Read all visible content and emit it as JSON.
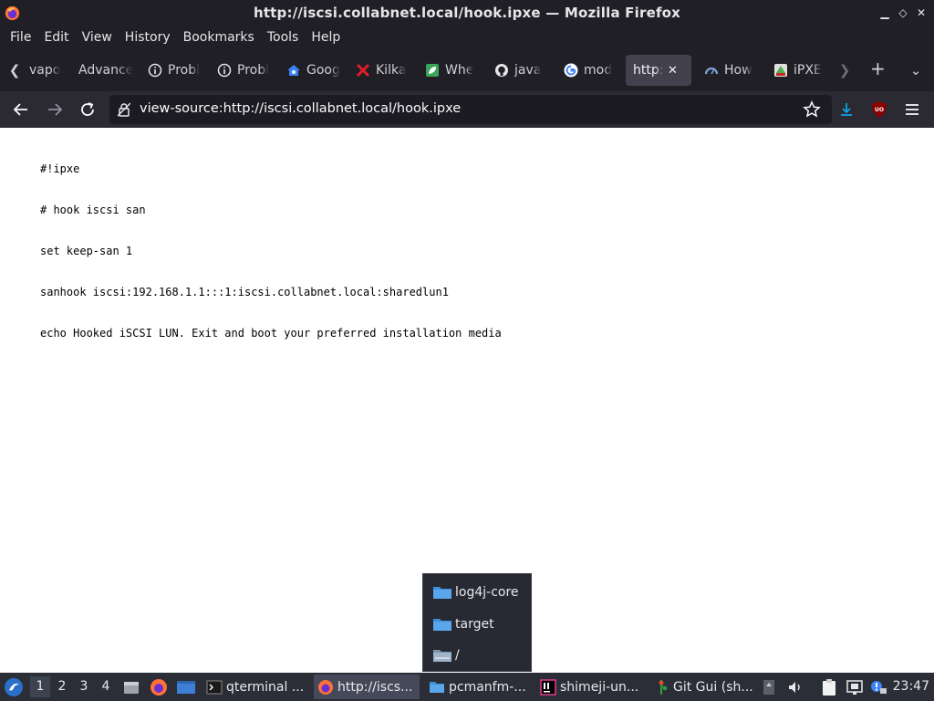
{
  "window": {
    "title": "http://iscsi.collabnet.local/hook.ipxe — Mozilla Firefox"
  },
  "menu": [
    "File",
    "Edit",
    "View",
    "History",
    "Bookmarks",
    "Tools",
    "Help"
  ],
  "tabs": [
    {
      "label": "vapo",
      "icon": "none"
    },
    {
      "label": "Advance",
      "icon": "none"
    },
    {
      "label": "Probl",
      "icon": "info-icon"
    },
    {
      "label": "Probl",
      "icon": "info-icon"
    },
    {
      "label": "Goog",
      "icon": "home-icon"
    },
    {
      "label": "Kilka",
      "icon": "cross-icon"
    },
    {
      "label": "Whe",
      "icon": "leaf-icon"
    },
    {
      "label": "java",
      "icon": "github-icon"
    },
    {
      "label": "mod",
      "icon": "google-icon"
    },
    {
      "label": "http://",
      "icon": "none",
      "active": true
    },
    {
      "label": "How",
      "icon": "speedometer-icon"
    },
    {
      "label": "iPXE",
      "icon": "ipxe-icon"
    }
  ],
  "address_bar": {
    "url": "view-source:http://iscsi.collabnet.local/hook.ipxe"
  },
  "source": {
    "lines": [
      "#!ipxe",
      "# hook iscsi san",
      "set keep-san 1",
      "sanhook iscsi:192.168.1.1:::1:iscsi.collabnet.local:sharedlun1",
      "echo Hooked iSCSI LUN. Exit and boot your preferred installation media"
    ]
  },
  "popup_menu": {
    "items": [
      "log4j-core",
      "target",
      "/"
    ]
  },
  "taskbar": {
    "workspaces": [
      "1",
      "2",
      "3",
      "4"
    ],
    "active_workspace": "1",
    "tasks": [
      {
        "label": "qterminal ...",
        "icon": "terminal-icon"
      },
      {
        "label": "http://iscs...",
        "icon": "firefox-icon",
        "active": true
      },
      {
        "label": "pcmanfm-...",
        "icon": "folder-icon"
      },
      {
        "label": "shimeji-un...",
        "icon": "intellij-icon"
      },
      {
        "label": "Git Gui (sh...",
        "icon": "git-icon"
      }
    ],
    "clock": "23:47"
  },
  "colors": {
    "chrome_dark": "#1f1f25",
    "nav_bar": "#2b2a33",
    "url_field": "#1c1b22",
    "active_tab": "#42414d",
    "taskbar": "#2b2e37",
    "download_accent": "#0ea5e9",
    "ublock_red": "#8b0000"
  }
}
